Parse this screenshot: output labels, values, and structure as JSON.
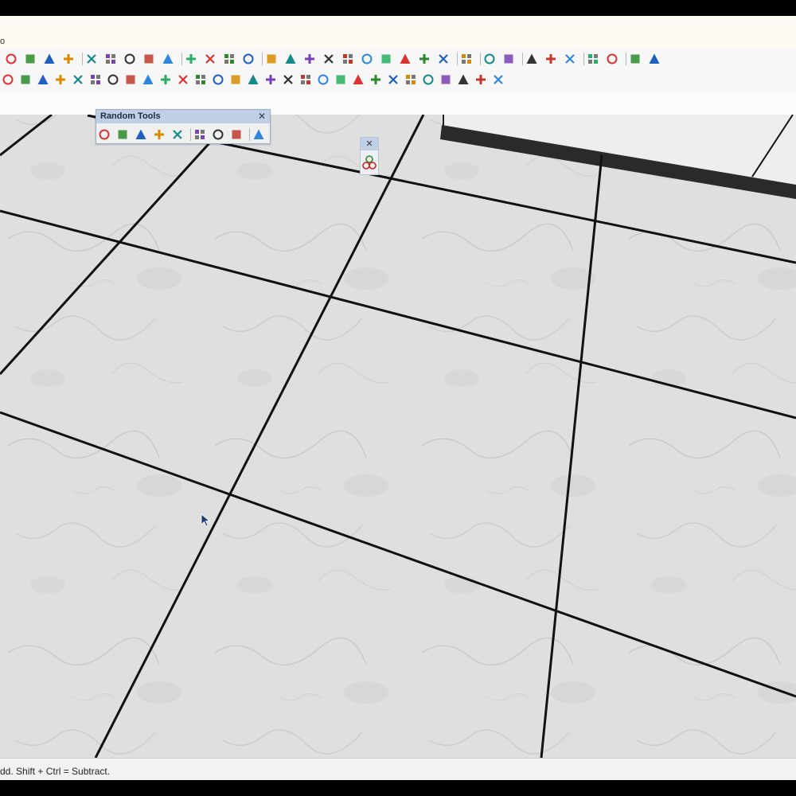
{
  "menubar": {
    "fragment": "o"
  },
  "random_tools": {
    "title": "Random Tools",
    "close_symbol": "✕"
  },
  "mini_panel": {
    "close_symbol": "✕"
  },
  "statusbar": {
    "text": "dd. Shift + Ctrl = Subtract."
  },
  "colors": {
    "toolbar_bg": "#f7f7f7",
    "panel_title_bg": "#bfd0e6",
    "floor": "#dcdcdc"
  },
  "toolbar_row1_icons": [
    "redo-red-icon",
    "push-red-icon",
    "zoom-icon",
    "zoom-extents-icon",
    "orbit-icon",
    "layers-icon",
    "stack-icon",
    "components-icon",
    "settings-circle-icon",
    "paint-icon",
    "section-icon",
    "copy-icon",
    "fill-icon",
    "add-circle-icon",
    "shield-icon",
    "texture-icon",
    "checker-icon",
    "cloud-icon",
    "gear-icon",
    "frame-icon",
    "info-icon",
    "cart-icon",
    "user-icon",
    "align-icon",
    "badge-icon",
    "shield-plugin-icon",
    "tree-icon",
    "leaf-icon",
    "fx-icon",
    "skull-icon",
    "camera-icon",
    "window-icon",
    "sparkle-icon"
  ],
  "toolbar_row2_icons": [
    "red-plus-icon",
    "green-plus-icon",
    "blue-x-icon",
    "tile-icon",
    "teal-triangle-icon",
    "green-tree-icon",
    "warning-icon",
    "orange-arc-icon",
    "curve-icon",
    "swirl-icon",
    "star-icon",
    "bucket-icon",
    "green-arrows-icon",
    "red-rotate-icon",
    "book-icon",
    "cube-red-icon",
    "cube-pink-icon",
    "red-dot-icon",
    "green-box-icon",
    "grid-tile-icon",
    "grid-tile2-icon",
    "table-icon",
    "table2-icon",
    "yellow-grid-icon",
    "yellow-grid2-icon",
    "yellow-grid3-icon",
    "red-dots-icon",
    "circle-dots-icon",
    "qr-icon"
  ],
  "random_tools_icons": [
    "drop-plane-icon",
    "raise-icon",
    "drop-pin-icon",
    "drop-pin2-icon",
    "drop-pin3-icon",
    "bar-chart-icon",
    "random-rotate-icon",
    "random-scale-icon",
    "eye-icon"
  ]
}
